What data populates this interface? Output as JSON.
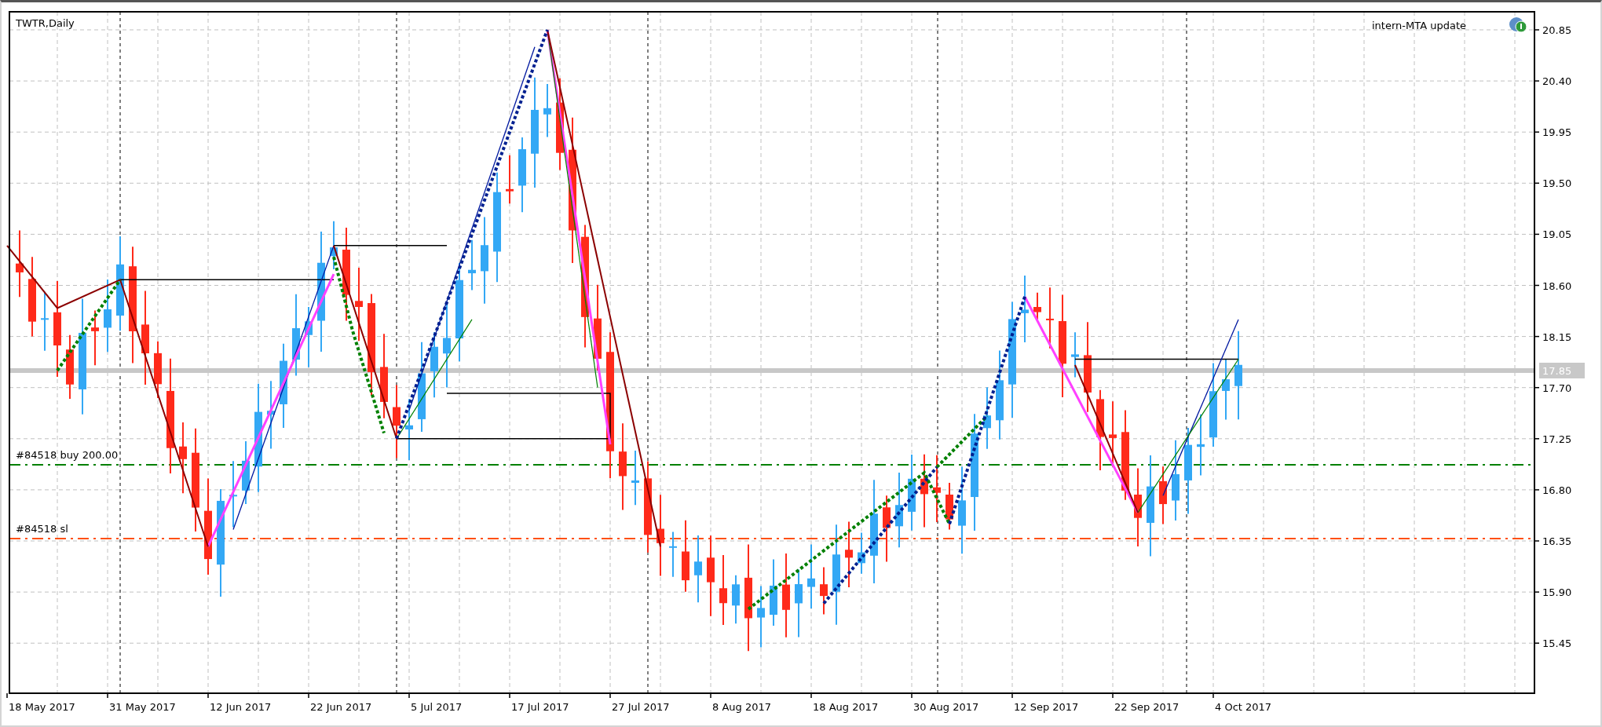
{
  "chart": {
    "title": "TWTR,Daily",
    "indicator": {
      "label": "intern-MTA update"
    },
    "price_ticks": [
      "20.85",
      "20.40",
      "19.95",
      "19.50",
      "19.05",
      "18.60",
      "18.15",
      "17.70",
      "17.25",
      "16.80",
      "16.35",
      "15.90",
      "15.45"
    ],
    "date_ticks": [
      "18 May 2017",
      "31 May 2017",
      "12 Jun 2017",
      "22 Jun 2017",
      "5 Jul 2017",
      "17 Jul 2017",
      "27 Jul 2017",
      "8 Aug 2017",
      "18 Aug 2017",
      "30 Aug 2017",
      "12 Sep 2017",
      "22 Sep 2017",
      "4 Oct 2017"
    ],
    "current_price": "17.85",
    "orders": [
      {
        "kind": "entry",
        "label": "#84518 buy 200.00"
      },
      {
        "kind": "stop",
        "label": "#84518 sl"
      }
    ]
  }
}
